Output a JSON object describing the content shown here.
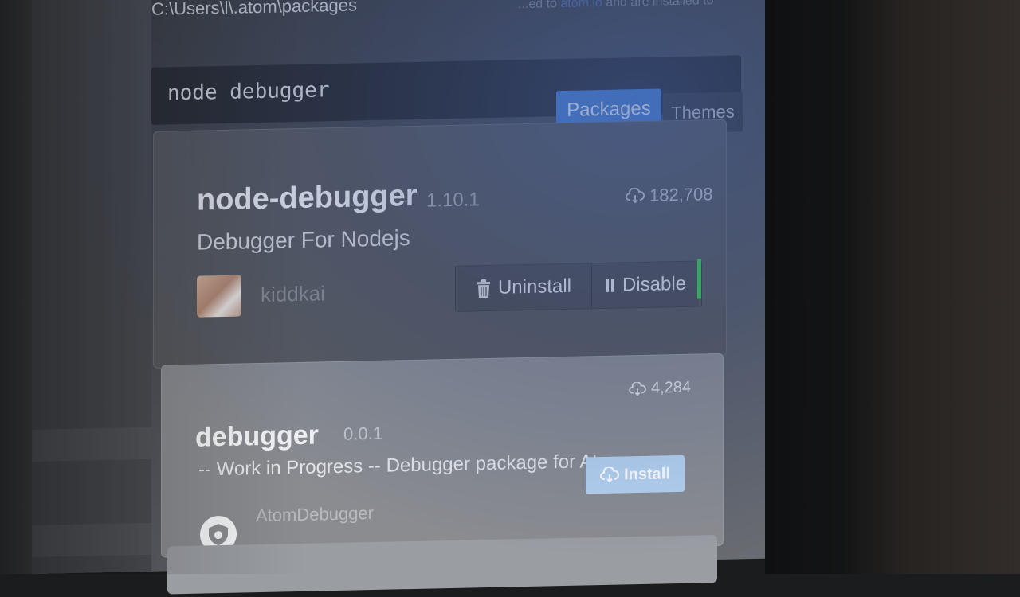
{
  "header": {
    "install_path": "C:\\Users\\l\\.atom\\packages",
    "install_note_prefix": "...ed to ",
    "install_note_link": "atom.io",
    "install_note_suffix": " and are installed to"
  },
  "search": {
    "value": "node debugger"
  },
  "tabs": [
    {
      "label": "Packages",
      "active": true
    },
    {
      "label": "Themes",
      "active": false
    }
  ],
  "packages": [
    {
      "name": "node-debugger",
      "version": "1.10.1",
      "description": "Debugger For Nodejs",
      "downloads": "182,708",
      "owner": "kiddkai",
      "actions": {
        "uninstall": "Uninstall",
        "disable": "Disable"
      },
      "enabled_indicator": "#37d04a"
    },
    {
      "name": "debugger",
      "version": "0.0.1",
      "description": "-- Work in Progress -- Debugger package for Atom",
      "downloads": "4,284",
      "owner": "AtomDebugger",
      "actions": {
        "install": "Install"
      }
    }
  ],
  "colors": {
    "accent": "#4a83d6",
    "card_bg": "#58595c",
    "enabled_green": "#37d04a"
  }
}
